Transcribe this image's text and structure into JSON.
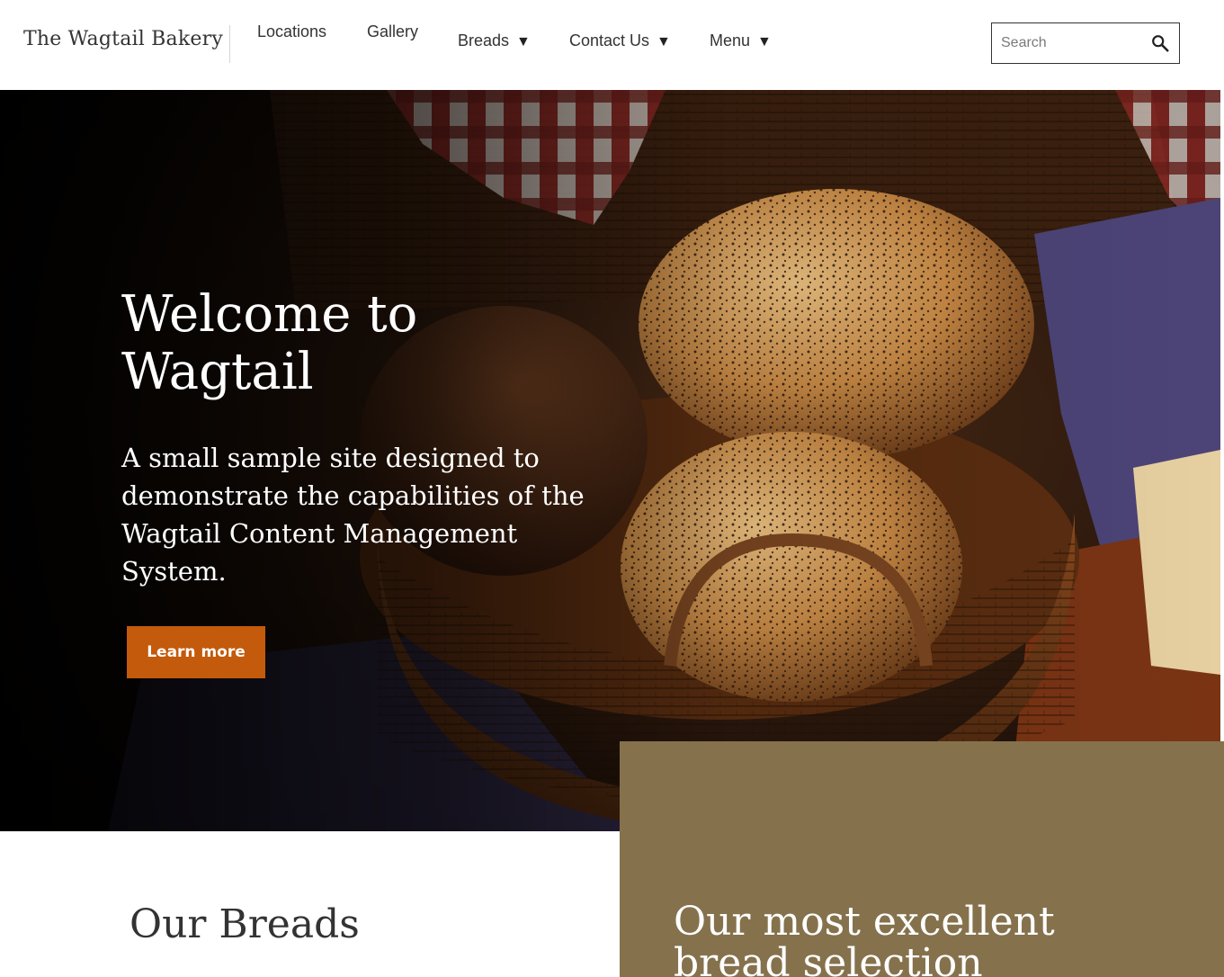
{
  "header": {
    "brand": "The Wagtail Bakery",
    "nav": {
      "locations": "Locations",
      "gallery": "Gallery",
      "breads": "Breads",
      "contact_us": "Contact Us",
      "menu": "Menu"
    },
    "dropdown_caret": "▼",
    "search": {
      "placeholder": "Search",
      "value": ""
    }
  },
  "hero": {
    "title": "Welcome to Wagtail",
    "subtitle": "A small sample site designed to demonstrate the capabilities of the Wagtail Content Management System.",
    "cta_label": "Learn more"
  },
  "sections": {
    "breads_heading": "Our Breads",
    "promo_title": "Our most excellent bread selection"
  },
  "colors": {
    "cta_background": "#c45a0b",
    "promo_panel": "#85724d",
    "text_dark": "#333333"
  },
  "icons": {
    "search": "search-icon",
    "caret": "caret-down-icon"
  }
}
